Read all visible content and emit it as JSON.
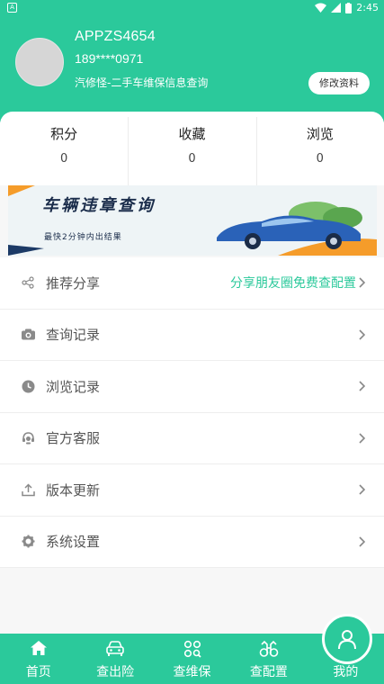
{
  "status_bar": {
    "time": "2:45"
  },
  "profile": {
    "username": "APPZS4654",
    "phone": "189****0971",
    "subtitle": "汽修怪-二手车维保信息查询",
    "edit_label": "修改资料"
  },
  "stats": [
    {
      "label": "积分",
      "value": "0"
    },
    {
      "label": "收藏",
      "value": "0"
    },
    {
      "label": "浏览",
      "value": "0"
    }
  ],
  "banner": {
    "title": "车辆违章查询",
    "subtitle": "最快2分钟内出结果"
  },
  "menu": [
    {
      "label": "推荐分享",
      "extra": "分享朋友圈免费查配置",
      "icon": "share-icon"
    },
    {
      "label": "查询记录",
      "icon": "camera-icon"
    },
    {
      "label": "浏览记录",
      "icon": "clock-icon"
    },
    {
      "label": "官方客服",
      "icon": "headset-icon"
    },
    {
      "label": "版本更新",
      "icon": "upload-icon"
    },
    {
      "label": "系统设置",
      "icon": "gear-icon"
    }
  ],
  "tabs": [
    {
      "label": "首页",
      "icon": "home-icon"
    },
    {
      "label": "查出险",
      "icon": "car-icon"
    },
    {
      "label": "查维保",
      "icon": "grid-search-icon"
    },
    {
      "label": "查配置",
      "icon": "binoculars-icon"
    },
    {
      "label": "我的",
      "icon": "person-icon",
      "active": true
    }
  ],
  "colors": {
    "primary": "#2bc99b",
    "background": "#f7f7f7"
  }
}
